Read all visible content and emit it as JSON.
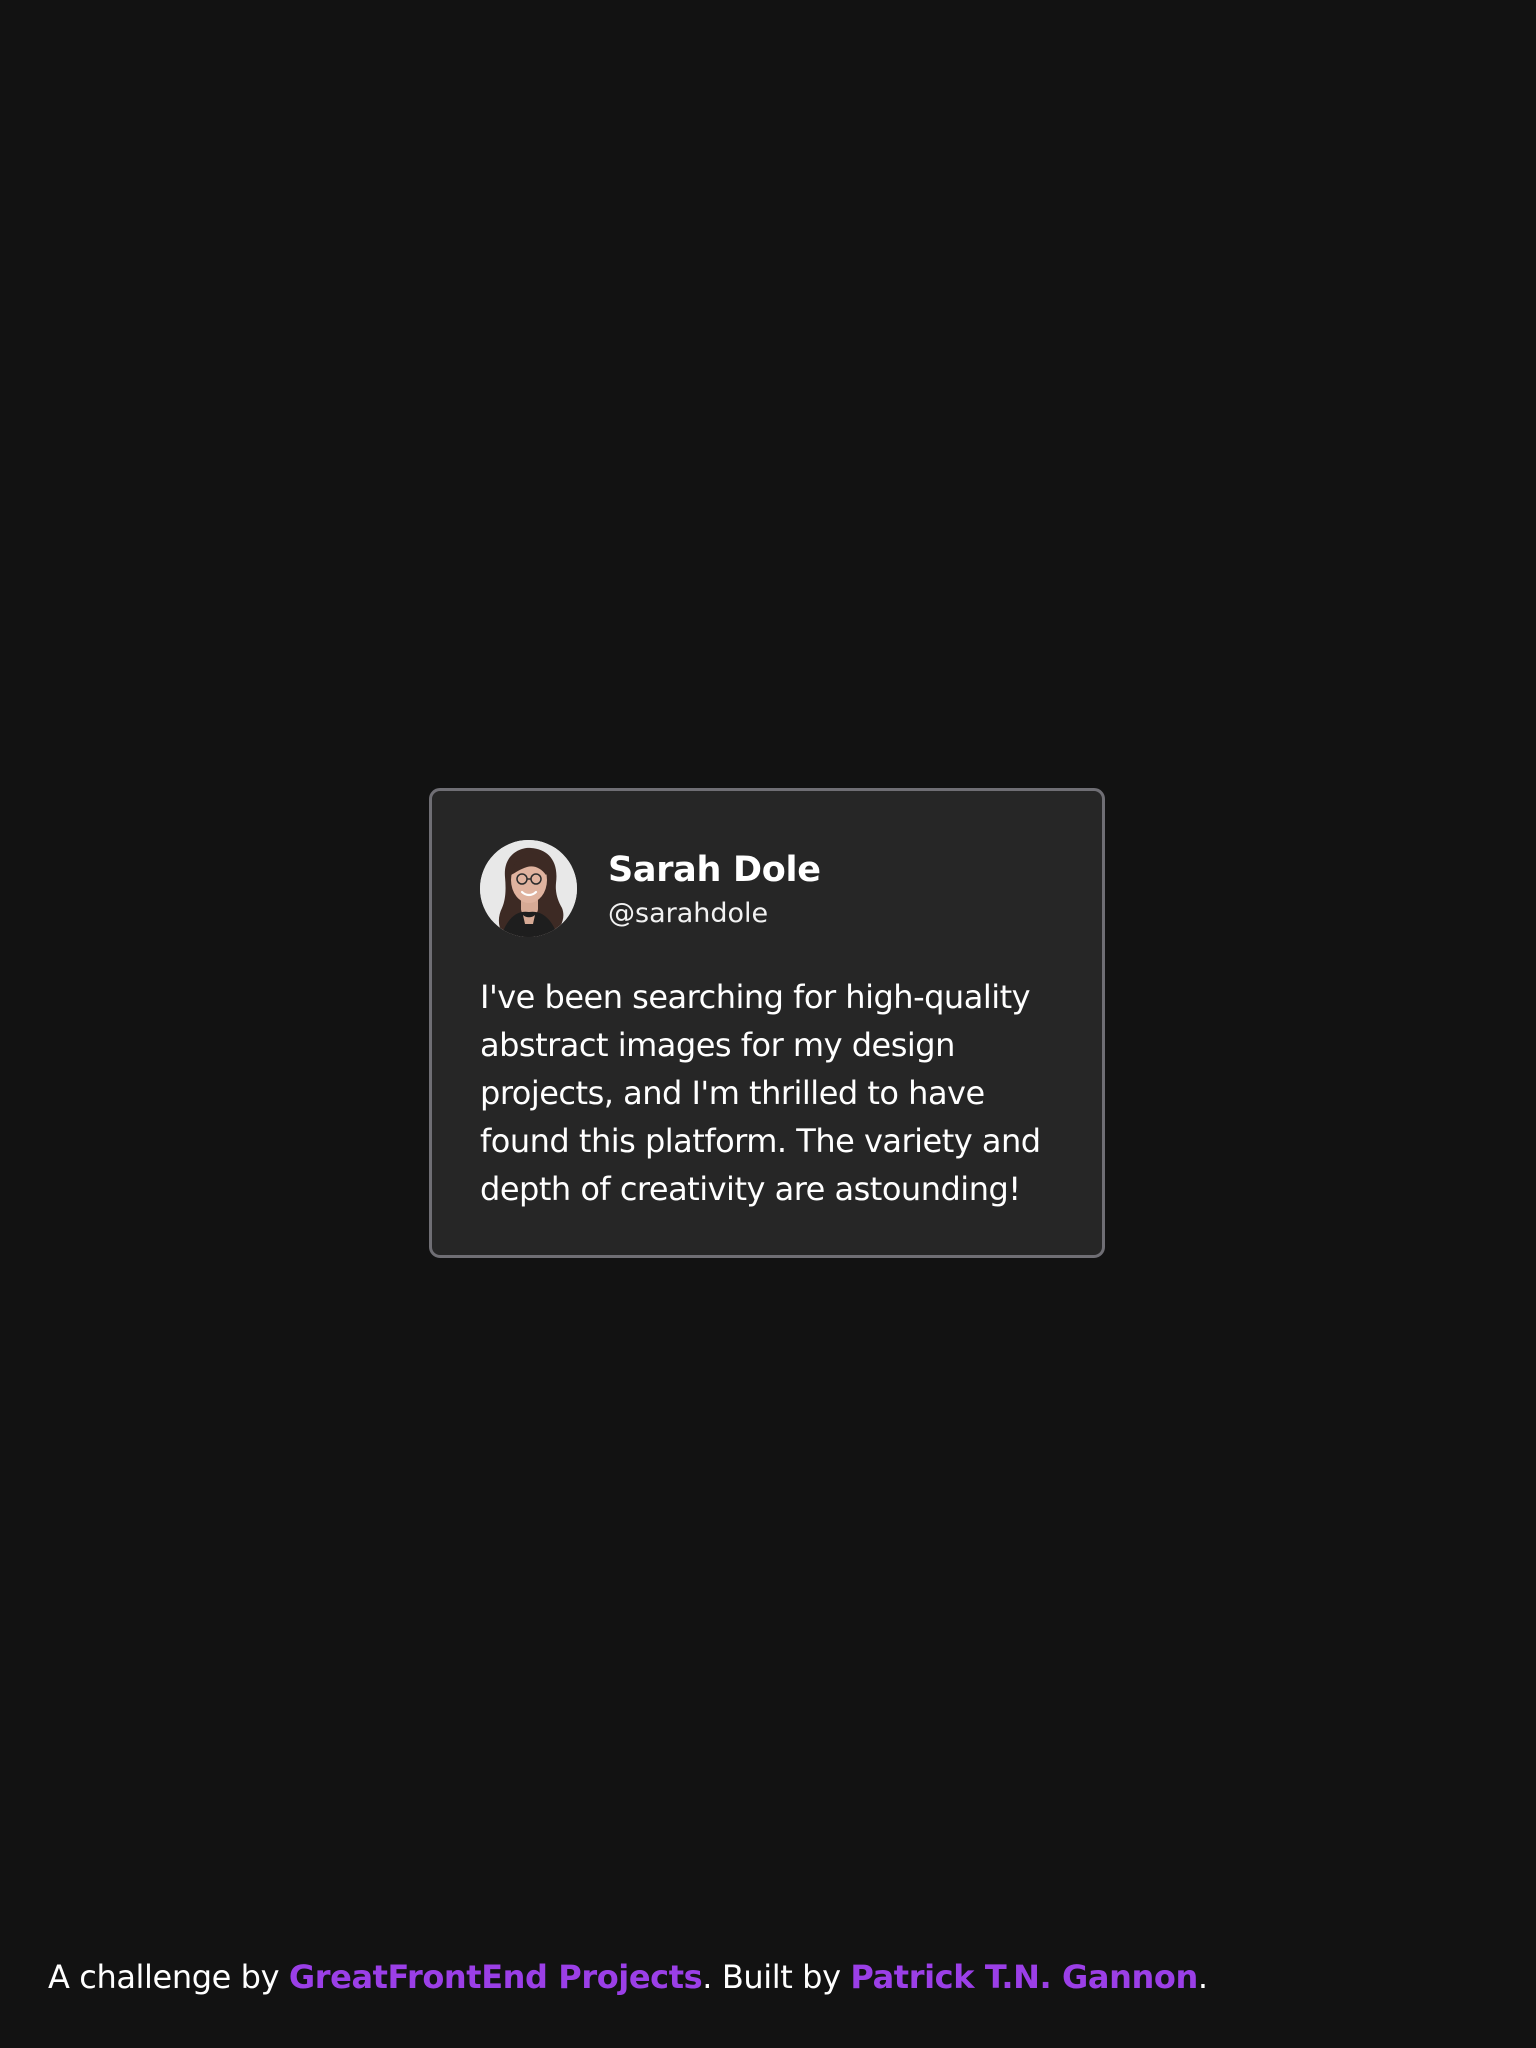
{
  "testimonial": {
    "avatar_icon": "user-avatar",
    "name": "Sarah Dole",
    "handle": "@sarahdole",
    "message": "I've been searching for high-quality abstract images for my design projects, and I'm thrilled to have found this platform. The variety and depth of creativity are astounding!"
  },
  "footer": {
    "prefix": "A challenge by ",
    "challenge_link": "GreatFrontEnd Projects",
    "middle": ". Built by ",
    "author_link": "Patrick T.N. Gannon",
    "suffix": "."
  },
  "colors": {
    "background": "#121212",
    "card_background": "#262626",
    "card_border": "#6f6e74",
    "link": "#9b3fe7",
    "text": "#ffffff"
  }
}
